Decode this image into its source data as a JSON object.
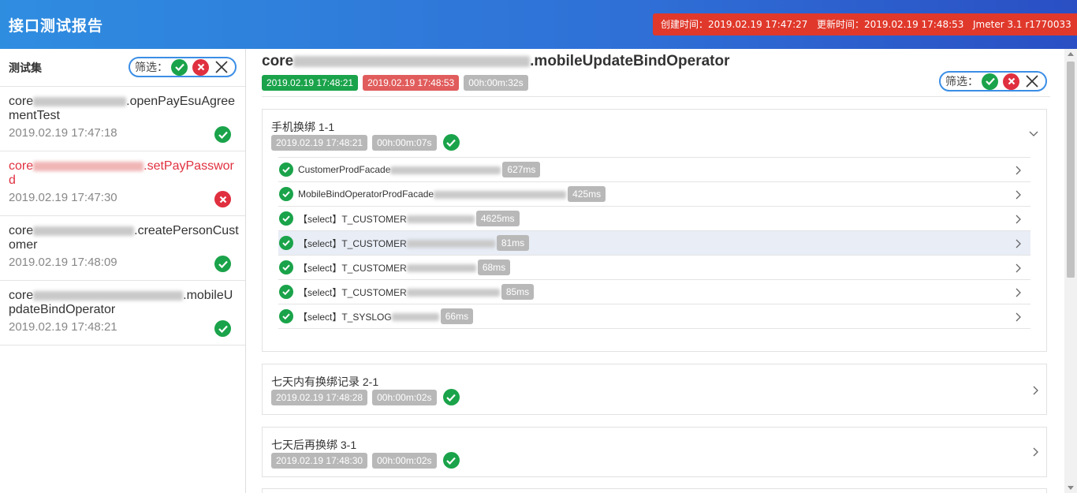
{
  "header": {
    "title": "接口测试报告",
    "created": "创建时间：2019.02.19 17:47:27",
    "updated": "更新时间：2019.02.19 17:48:53",
    "jmeter": "Jmeter 3.1 r1770033"
  },
  "sidebar": {
    "label": "测试集",
    "filter_label": "筛选：",
    "items": [
      {
        "name_prefix": "core",
        "name_suffix": "openPayEsuAgreementTest",
        "time": "2019.02.19 17:47:18",
        "status": "pass"
      },
      {
        "name_prefix": "core",
        "name_suffix": "setPayPassword",
        "time": "2019.02.19 17:47:30",
        "status": "fail"
      },
      {
        "name_prefix": "core",
        "name_suffix": "createPersonCustomer",
        "time": "2019.02.19 17:48:09",
        "status": "pass"
      },
      {
        "name_prefix": "core",
        "name_suffix": "mobileUpdateBindOperator",
        "time": "2019.02.19 17:48:21",
        "status": "pass"
      }
    ]
  },
  "main": {
    "title_prefix": "core",
    "title_suffix": "mobileUpdateBindOperator",
    "start": "2019.02.19 17:48:21",
    "end": "2019.02.19 17:48:53",
    "duration": "00h:00m:32s",
    "filter_label": "筛选：",
    "cards": [
      {
        "name": "手机换绑 1-1",
        "start": "2019.02.19 17:48:21",
        "duration": "00h:00m:07s",
        "expanded": true,
        "steps": [
          {
            "name": "CustomerProdFacade",
            "ms": "627ms"
          },
          {
            "name": "MobileBindOperatorProdFacade",
            "ms": "425ms"
          },
          {
            "name": "【select】T_CUSTOMER",
            "ms": "4625ms"
          },
          {
            "name": "【select】T_CUSTOMER",
            "ms": "81ms"
          },
          {
            "name": "【select】T_CUSTOMER",
            "ms": "68ms"
          },
          {
            "name": "【select】T_CUSTOMER",
            "ms": "85ms"
          },
          {
            "name": "【select】T_SYSLOG",
            "ms": "66ms"
          }
        ]
      },
      {
        "name": "七天内有换绑记录 2-1",
        "start": "2019.02.19 17:48:28",
        "duration": "00h:00m:02s",
        "expanded": false
      },
      {
        "name": "七天后再换绑 3-1",
        "start": "2019.02.19 17:48:30",
        "duration": "00h:00m:02s",
        "expanded": false
      }
    ]
  },
  "colors": {
    "pass": "#1aa34a",
    "fail": "#e0303f",
    "accent": "#3b8ee6",
    "header_badge": "#e0392b"
  }
}
